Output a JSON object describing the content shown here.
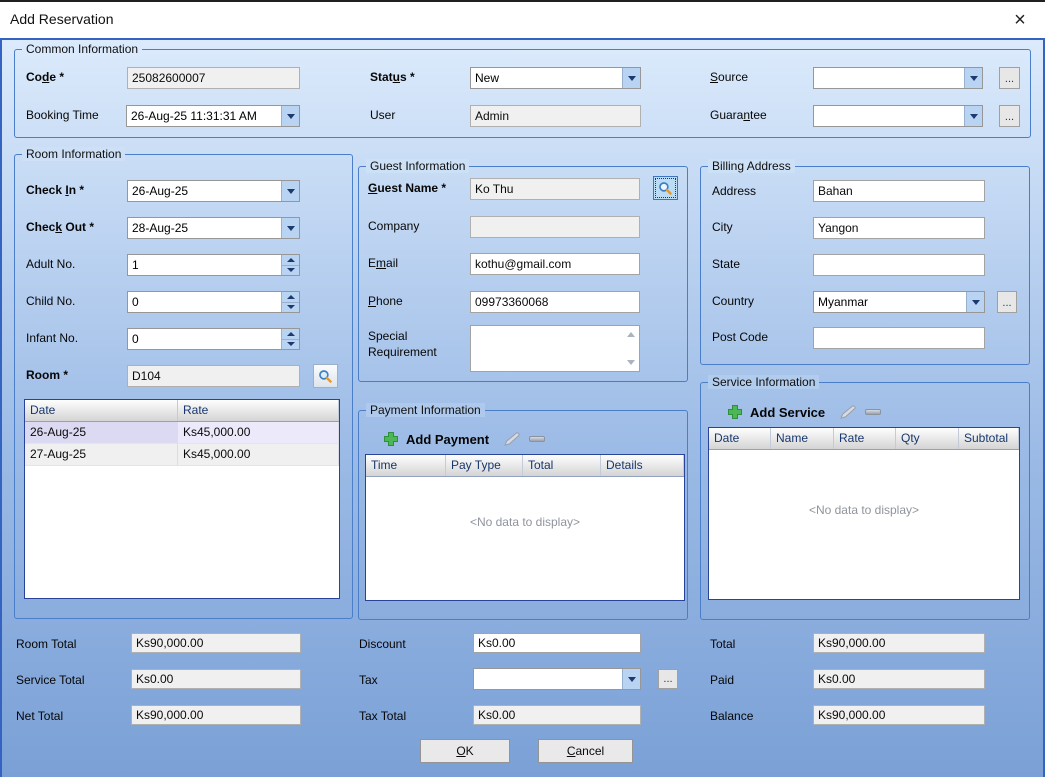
{
  "window": {
    "title": "Add Reservation",
    "close_glyph": "×"
  },
  "colors": {
    "frame_blue": "#3563c2",
    "bg_top": "#dcebfc",
    "bg_bottom": "#7aa0d6",
    "group_border": "#4a7ec8",
    "selected_cell": "#dcd9f3",
    "add_green": "#4db655",
    "readonly_bg": "#f0f0f0",
    "combo_button": "#b9d3f3"
  },
  "icons": {
    "close": "x-cross",
    "search": "magnifier",
    "add": "green-plus",
    "edit": "pencil",
    "remove": "minus-bar",
    "dropdown": "down-triangle",
    "spin": "up-down-triangles",
    "browse": "..."
  },
  "common": {
    "legend": "Common Information",
    "code_label": "Code *",
    "code_value": "25082600007",
    "booking_label": "Booking Time",
    "booking_value": "26-Aug-25 11:31:31 AM",
    "status_label": "Status *",
    "status_value": "New",
    "user_label": "User",
    "user_value": "Admin",
    "source_label": "Source",
    "source_value": "",
    "guarantee_label": "Guarantee",
    "guarantee_value": "",
    "browse": "..."
  },
  "room": {
    "legend": "Room Information",
    "check_in_label": "Check In *",
    "check_in_value": "26-Aug-25",
    "check_out_label": "Check Out *",
    "check_out_value": "28-Aug-25",
    "adult_label": "Adult No.",
    "adult_value": "1",
    "child_label": "Child No.",
    "child_value": "0",
    "infant_label": "Infant No.",
    "infant_value": "0",
    "room_label": "Room *",
    "room_value": "D104",
    "table": {
      "col_date": "Date",
      "col_rate": "Rate",
      "rows": [
        {
          "date": "26-Aug-25",
          "rate": "Ks45,000.00"
        },
        {
          "date": "27-Aug-25",
          "rate": "Ks45,000.00"
        }
      ]
    }
  },
  "guest": {
    "legend": "Guest Information",
    "name_label": "Guest Name *",
    "name_value": "Ko Thu",
    "company_label": "Company",
    "company_value": "",
    "email_label": "Email",
    "email_value": "kothu@gmail.com",
    "phone_label": "Phone",
    "phone_value": "09973360068",
    "special_label": "Special Requirement",
    "special_value": ""
  },
  "billing": {
    "legend": "Billing Address",
    "address_label": "Address",
    "address_value": "Bahan",
    "city_label": "City",
    "city_value": "Yangon",
    "state_label": "State",
    "state_value": "",
    "country_label": "Country",
    "country_value": "Myanmar",
    "postcode_label": "Post Code",
    "postcode_value": "",
    "browse": "..."
  },
  "payment": {
    "legend": "Payment Information",
    "add_label": "Add Payment",
    "columns": {
      "time": "Time",
      "pay_type": "Pay Type",
      "total": "Total",
      "details": "Details"
    },
    "empty_text": "<No data to display>"
  },
  "service": {
    "legend": "Service Information",
    "add_label": "Add Service",
    "columns": {
      "date": "Date",
      "name": "Name",
      "rate": "Rate",
      "qty": "Qty",
      "subtotal": "Subtotal"
    },
    "empty_text": "<No data to display>"
  },
  "totals": {
    "room_total_label": "Room Total",
    "room_total_value": "Ks90,000.00",
    "service_total_label": "Service Total",
    "service_total_value": "Ks0.00",
    "net_total_label": "Net Total",
    "net_total_value": "Ks90,000.00",
    "discount_label": "Discount",
    "discount_value": "Ks0.00",
    "tax_label": "Tax",
    "tax_value": "",
    "tax_total_label": "Tax Total",
    "tax_total_value": "Ks0.00",
    "total_label": "Total",
    "total_value": "Ks90,000.00",
    "paid_label": "Paid",
    "paid_value": "Ks0.00",
    "balance_label": "Balance",
    "balance_value": "Ks90,000.00"
  },
  "footer": {
    "ok": "OK",
    "cancel": "Cancel"
  }
}
